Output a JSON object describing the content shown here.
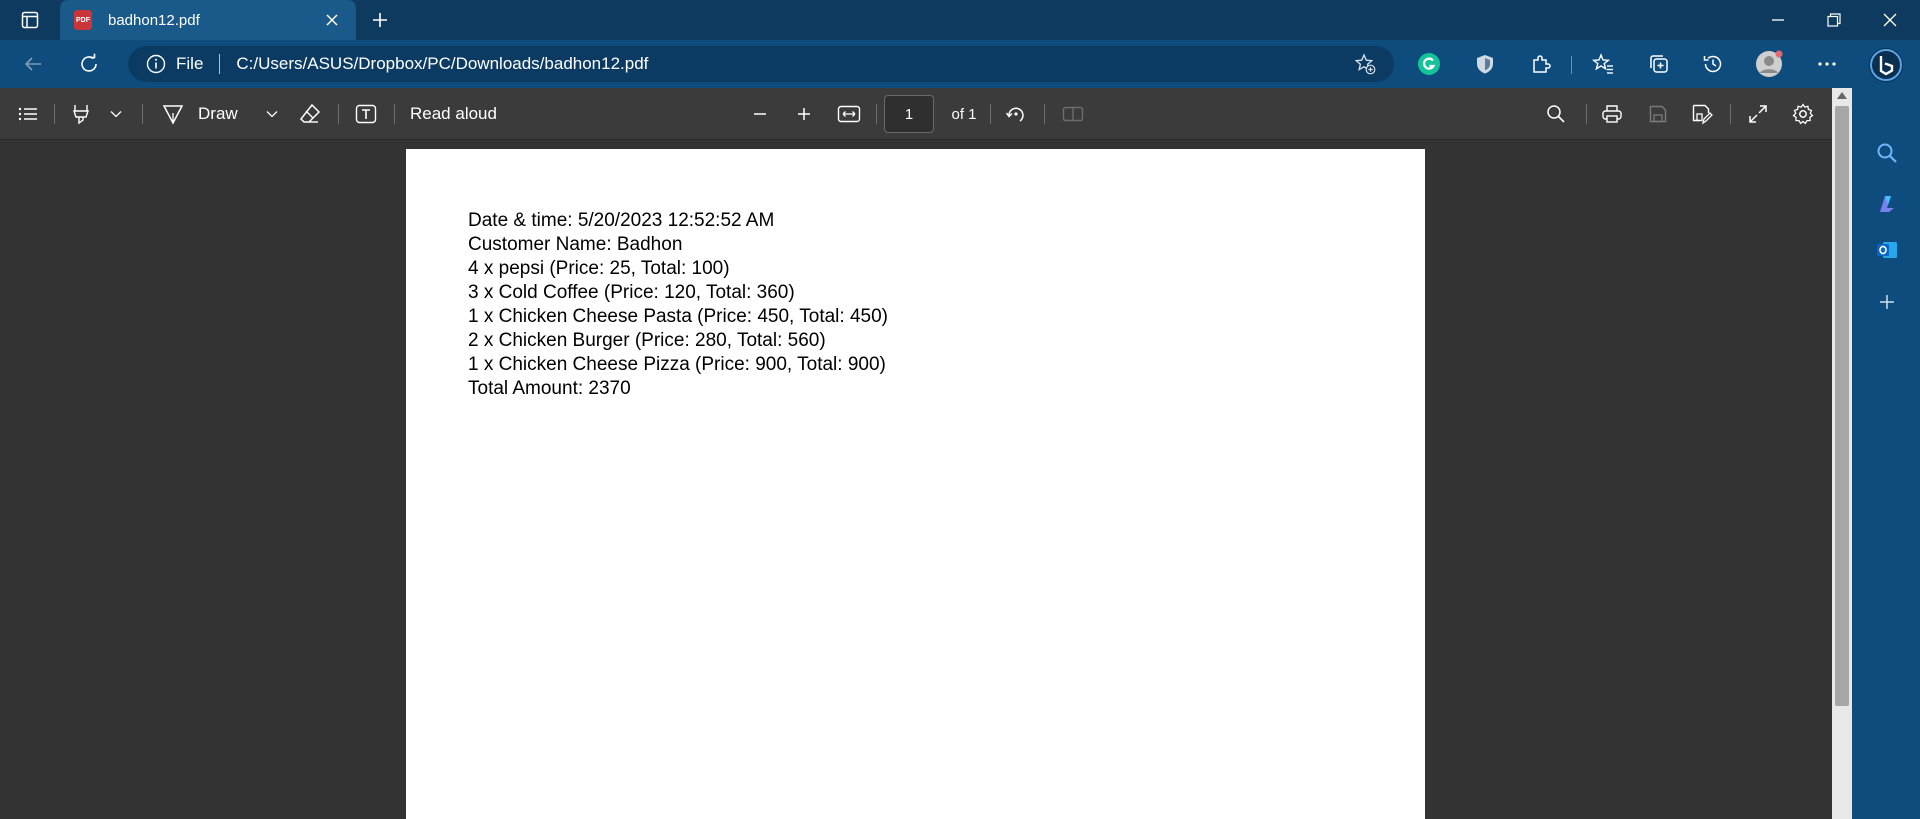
{
  "tab": {
    "title": "badhon12.pdf",
    "pdf_badge": "PDF"
  },
  "address": {
    "scheme_label": "File",
    "url": "C:/Users/ASUS/Dropbox/PC/Downloads/badhon12.pdf"
  },
  "toolbar": {
    "draw_label": "Draw",
    "read_aloud_label": "Read aloud",
    "page_number": "1",
    "page_total": "of 1"
  },
  "document": {
    "lines": [
      "Date & time: 5/20/2023 12:52:52 AM",
      "Customer Name: Badhon",
      "4 x pepsi (Price: 25, Total: 100)",
      "3 x Cold Coffee (Price: 120, Total: 360)",
      "1 x Chicken Cheese Pasta (Price: 450, Total: 450)",
      "2 x Chicken Burger (Price: 280, Total: 560)",
      "1 x Chicken Cheese Pizza (Price: 900, Total: 900)",
      "Total Amount: 2370"
    ]
  },
  "icons": {
    "tab_actions": "tab-actions-icon",
    "close_tab": "close-icon",
    "new_tab": "plus-icon",
    "minimize": "minimize-icon",
    "restore": "restore-icon",
    "close_window": "close-icon",
    "back": "back-arrow-icon",
    "refresh": "refresh-icon",
    "info": "info-icon",
    "favorite_add": "star-add-icon",
    "grammarly": "grammarly-icon",
    "shield": "shield-icon",
    "extensions": "puzzle-icon",
    "favorites": "favorites-icon",
    "collections": "collections-icon",
    "history": "history-icon",
    "profile": "profile-avatar-icon",
    "more": "more-dots-icon",
    "bing": "bing-icon"
  },
  "colors": {
    "titlebar": "#0d3a5e",
    "addressbar": "#0f4c7e",
    "pdf_toolbar": "#3b3b3b",
    "viewer_bg": "#333333",
    "grammarly": "#15c39a"
  }
}
